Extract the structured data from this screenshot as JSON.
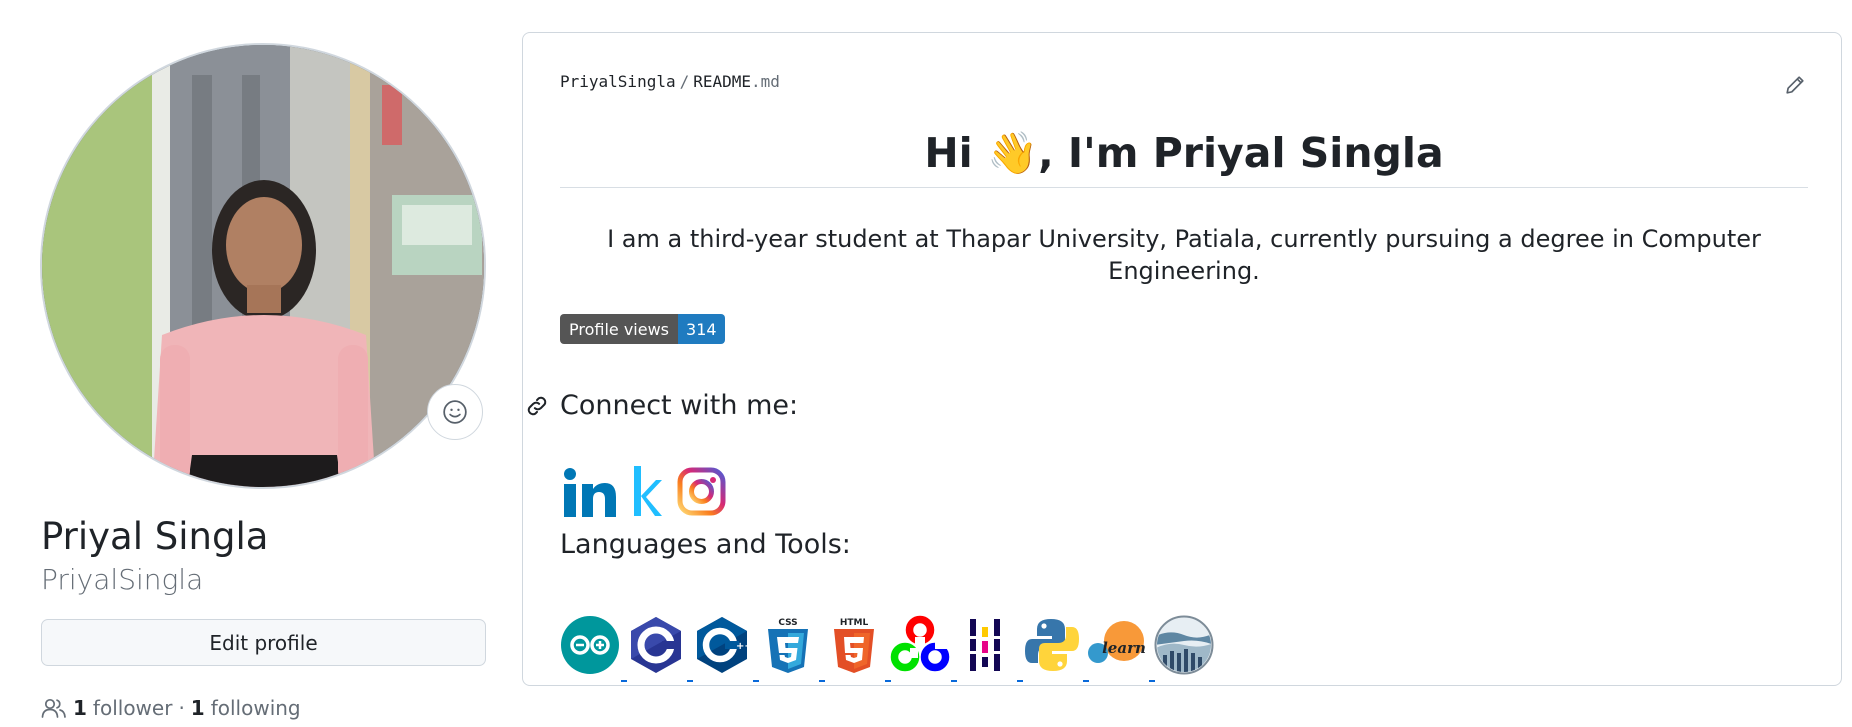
{
  "profile": {
    "full_name": "Priyal Singla",
    "login": "PriyalSingla",
    "edit_label": "Edit profile",
    "followers_count": "1",
    "followers_label": "follower",
    "separator": "·",
    "following_count": "1",
    "following_label": "following"
  },
  "readme": {
    "path_owner": "PriyalSingla",
    "path_sep": "/",
    "path_file": "README",
    "path_ext": ".md",
    "heading_pre": "Hi ",
    "heading_emoji": "👋",
    "heading_post": ", I'm Priyal Singla",
    "intro": "I am a third-year student at Thapar University, Patiala, currently pursuing a degree in Computer Engineering.",
    "views_badge": {
      "label": "Profile views",
      "count": "314"
    },
    "connect_heading": "Connect with me:",
    "social_links": [
      "linkedin-icon",
      "kaggle-icon",
      "instagram-icon"
    ],
    "languages_heading": "Languages and Tools:",
    "tools": [
      "arduino-icon",
      "c-icon",
      "cplusplus-icon",
      "css3-icon",
      "html5-icon",
      "opencv-icon",
      "pandas-icon",
      "python-icon",
      "scikit-learn-icon",
      "seaborn-icon"
    ],
    "scikit_learn_text": "learn"
  },
  "colors": {
    "link": "#0969da",
    "badge_label_bg": "#555555",
    "badge_count_bg": "#1f7bc0",
    "border": "#d0d7de"
  }
}
